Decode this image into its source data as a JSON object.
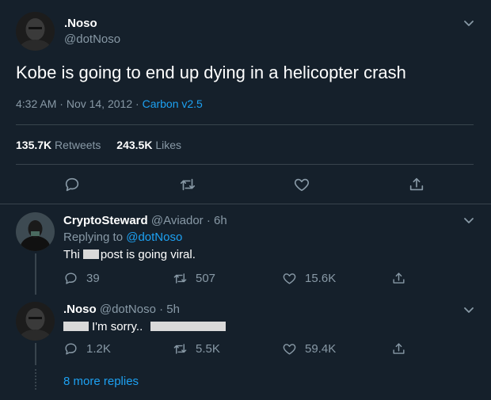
{
  "tweet": {
    "display_name": ".Noso",
    "handle": "@dotNoso",
    "text": "Kobe is going to end up dying in a helicopter crash",
    "time": "4:32 AM",
    "date": "Nov 14, 2012",
    "separator": "·",
    "source": "Carbon v2.5",
    "retweets_count": "135.7K",
    "retweets_label": "Retweets",
    "likes_count": "243.5K",
    "likes_label": "Likes"
  },
  "replies": [
    {
      "display_name": "CryptoSteward",
      "handle": "@Aviador",
      "separator": "·",
      "age": "6h",
      "replying_prefix": "Replying to",
      "replying_handle": "@dotNoso",
      "text_start": "Thi",
      "text_end": "post is going viral.",
      "reply_count": "39",
      "retweet_count": "507",
      "like_count": "15.6K"
    },
    {
      "display_name": ".Noso",
      "handle": "@dotNoso",
      "separator": "·",
      "age": "5h",
      "text": "I'm sorry..",
      "reply_count": "1.2K",
      "retweet_count": "5.5K",
      "like_count": "59.4K"
    }
  ],
  "more_replies": "8 more replies",
  "colors": {
    "background": "#15202b",
    "divider": "#38444d",
    "muted": "#8899a6",
    "accent": "#1da1f2"
  },
  "icons": [
    "chevron-down-icon",
    "reply-icon",
    "retweet-icon",
    "like-icon",
    "share-icon"
  ]
}
